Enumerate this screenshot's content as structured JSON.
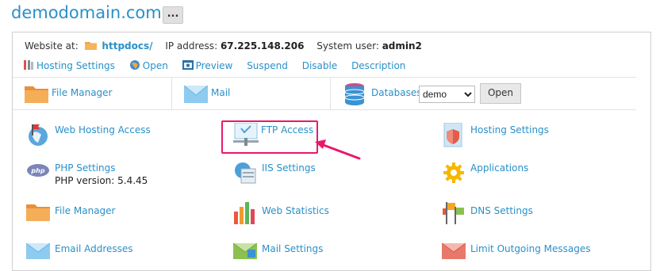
{
  "header": {
    "domain": "demodomain.com",
    "more": "..."
  },
  "info": {
    "website_label": "Website at:",
    "folder": "httpdocs/",
    "ip_label": "IP address:",
    "ip": "67.225.148.206",
    "user_label": "System user:",
    "user": "admin2"
  },
  "actions": [
    {
      "label": "Hosting Settings",
      "icon": "wrench-icon"
    },
    {
      "label": "Open",
      "icon": "globe-icon"
    },
    {
      "label": "Preview",
      "icon": "preview-icon"
    },
    {
      "label": "Suspend"
    },
    {
      "label": "Disable"
    },
    {
      "label": "Description"
    }
  ],
  "quick": {
    "file_manager": "File Manager",
    "mail": "Mail",
    "databases": "Databases",
    "db_selected": "demo",
    "open": "Open"
  },
  "tools": {
    "web_hosting_access": "Web Hosting Access",
    "ftp_access": "FTP Access",
    "hosting_settings": "Hosting Settings",
    "php_settings": "PHP Settings",
    "php_version": "PHP version: 5.4.45",
    "iis_settings": "IIS Settings",
    "applications": "Applications",
    "file_manager": "File Manager",
    "web_statistics": "Web Statistics",
    "dns_settings": "DNS Settings",
    "email_addresses": "Email Addresses",
    "mail_settings": "Mail Settings",
    "limit_outgoing": "Limit Outgoing Messages"
  },
  "colors": {
    "link": "#2a90c8",
    "highlight": "#e8196a"
  }
}
